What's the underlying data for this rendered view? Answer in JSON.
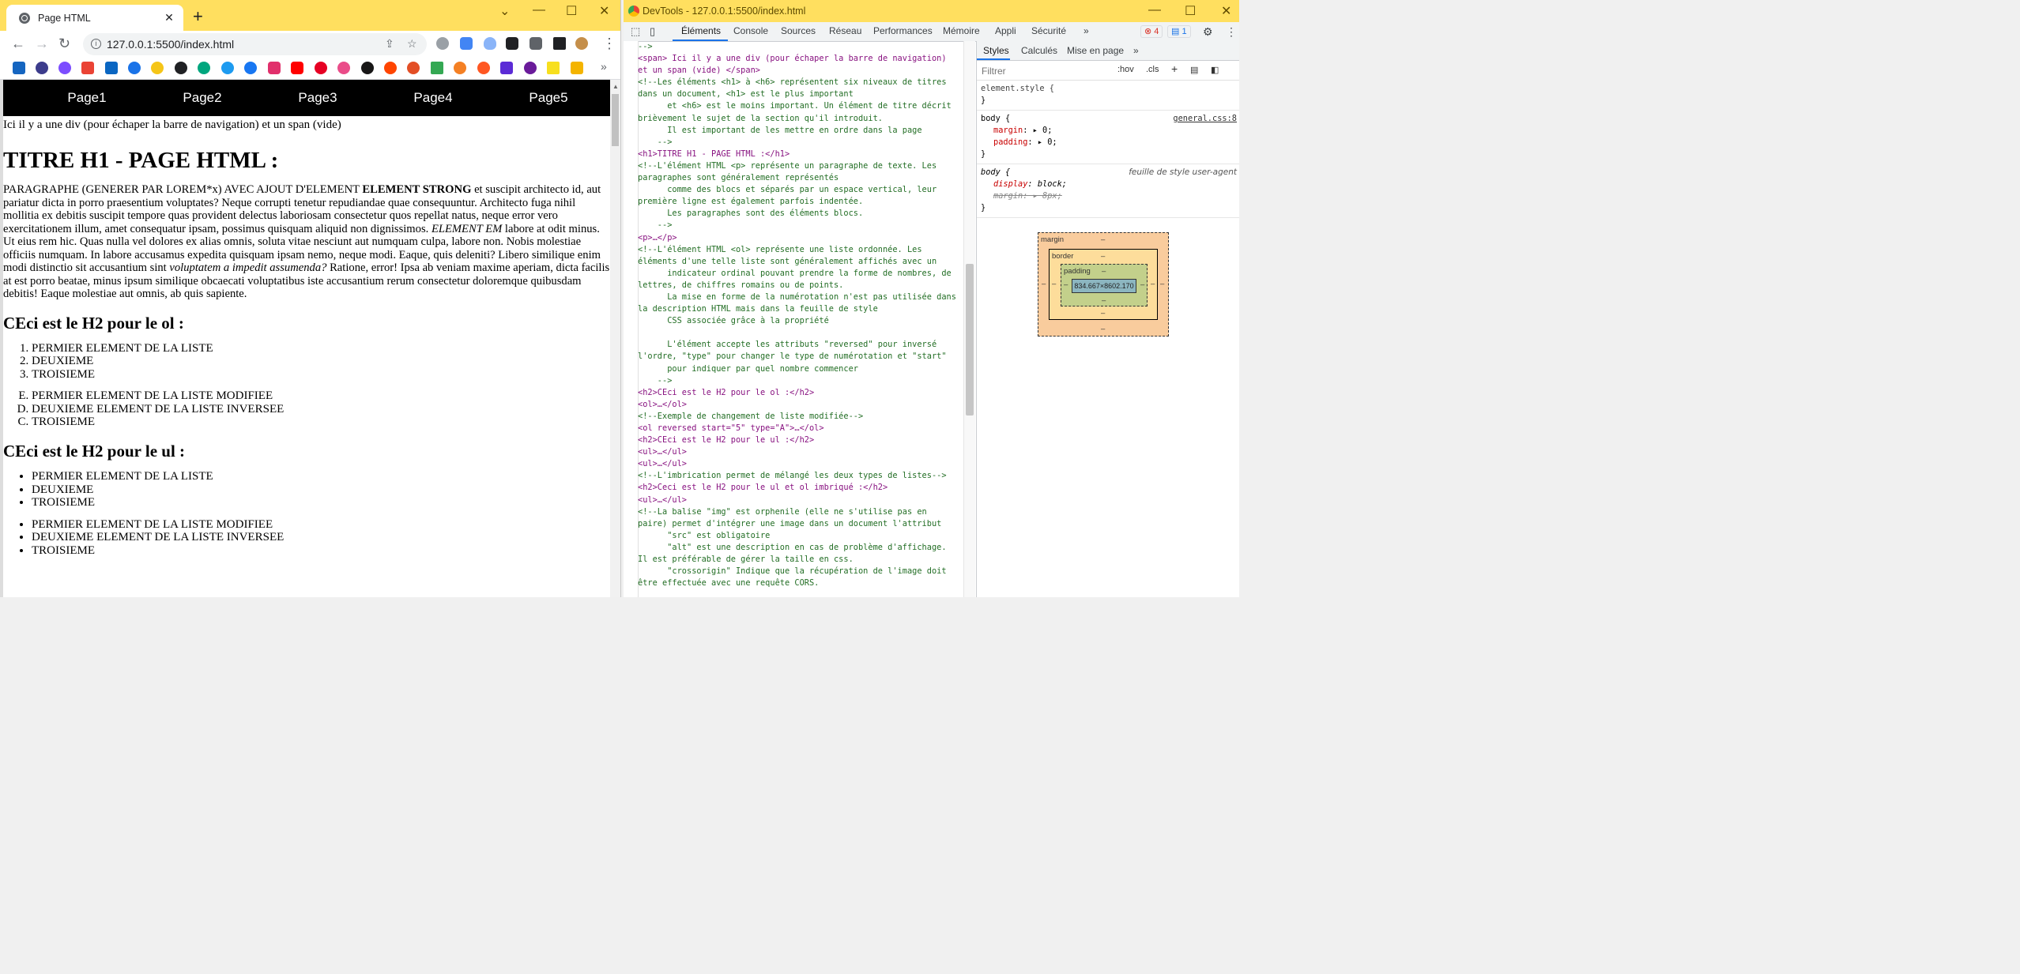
{
  "chrome": {
    "tab_title": "Page HTML",
    "tab_close": "✕",
    "new_tab": "+",
    "url": "127.0.0.1:5500/index.html",
    "window_controls": [
      "⌄",
      "—",
      "☐",
      "✕"
    ]
  },
  "page": {
    "nav": [
      "Page1",
      "Page2",
      "Page3",
      "Page4",
      "Page5"
    ],
    "intro": "Ici il y a une div (pour échaper la barre de navigation) et un span (vide)",
    "h1": "TITRE H1 - PAGE HTML :",
    "paragraph": {
      "part1": "PARAGRAPHE (GENERER PAR LOREM*x) AVEC AJOUT D'ELEMENT ",
      "strong": "ELEMENT STRONG",
      "part2": " et suscipit architecto id, aut pariatur dicta in porro praesentium voluptates? Neque corrupti tenetur repudiandae quae consequuntur. Architecto fuga nihil mollitia ex debitis suscipit tempore quas provident delectus laboriosam consectetur quos repellat natus, neque error vero exercitationem illum, amet consequatur ipsam, possimus quisquam aliquid non dignissimos. ",
      "em1": "ELEMENT EM",
      "part3": " labore at odit minus. Ut eius rem hic. Quas nulla vel dolores ex alias omnis, soluta vitae nesciunt aut numquam culpa, labore non. Nobis molestiae officiis numquam. In labore accusamus expedita quisquam ipsam nemo, neque modi. Eaque, quis deleniti? Libero similique enim modi distinctio sit accusantium sint ",
      "em2": "voluptatem a impedit assumenda?",
      "part4": " Ratione, error! Ipsa ab veniam maxime aperiam, dicta facilis at est porro beatae, minus ipsum similique obcaecati voluptatibus iste accusantium rerum consectetur doloremque quibusdam debitis! Eaque molestiae aut omnis, ab quis sapiente."
    },
    "h2_ol": "CEci est le H2 pour le ol :",
    "ol1": [
      "PERMIER ELEMENT DE LA LISTE",
      "DEUXIEME",
      "TROISIEME"
    ],
    "ol2": [
      "PERMIER ELEMENT DE LA LISTE MODIFIEE",
      "DEUXIEME ELEMENT DE LA LISTE INVERSEE",
      "TROISIEME"
    ],
    "h2_ul": "CEci est le H2 pour le ul :",
    "ul1": [
      "PERMIER ELEMENT DE LA LISTE",
      "DEUXIEME",
      "TROISIEME"
    ],
    "ul2": [
      "PERMIER ELEMENT DE LA LISTE MODIFIEE",
      "DEUXIEME ELEMENT DE LA LISTE INVERSEE",
      "TROISIEME"
    ]
  },
  "devtools": {
    "title": "DevTools - 127.0.0.1:5500/index.html",
    "tabs": [
      "Éléments",
      "Console",
      "Sources",
      "Réseau",
      "Performances",
      "Mémoire",
      "Appli",
      "Sécurité",
      "»"
    ],
    "errors": "4",
    "messages": "1",
    "elements_lines": [
      {
        "t": "cm",
        "s": "-->"
      },
      {
        "t": "tg",
        "s": "<span> Ici il y a une div (pour échaper la barre de navigation)"
      },
      {
        "t": "tg",
        "s": "et un span (vide) </span>"
      },
      {
        "t": "cm",
        "s": "<!--Les éléments <h1> à <h6> représentent six niveaux de titres"
      },
      {
        "t": "cm",
        "s": "dans un document, <h1> est le plus important"
      },
      {
        "t": "cm",
        "s": "      et <h6> est le moins important. Un élément de titre décrit"
      },
      {
        "t": "cm",
        "s": "brièvement le sujet de la section qu'il introduit."
      },
      {
        "t": "cm",
        "s": "      Il est important de les mettre en ordre dans la page"
      },
      {
        "t": "cm",
        "s": "    -->"
      },
      {
        "t": "tg",
        "s": "<h1>TITRE H1 - PAGE HTML :</h1>"
      },
      {
        "t": "cm",
        "s": "<!--L'élément HTML <p> représente un paragraphe de texte. Les"
      },
      {
        "t": "cm",
        "s": "paragraphes sont généralement représentés"
      },
      {
        "t": "cm",
        "s": "      comme des blocs et séparés par un espace vertical, leur"
      },
      {
        "t": "cm",
        "s": "première ligne est également parfois indentée."
      },
      {
        "t": "cm",
        "s": "      Les paragraphes sont des éléments blocs."
      },
      {
        "t": "cm",
        "s": "    -->"
      },
      {
        "t": "tgx",
        "s": "<p>…</p>"
      },
      {
        "t": "cm",
        "s": "<!--L'élément HTML <ol> représente une liste ordonnée. Les"
      },
      {
        "t": "cm",
        "s": "éléments d'une telle liste sont généralement affichés avec un"
      },
      {
        "t": "cm",
        "s": "      indicateur ordinal pouvant prendre la forme de nombres, de"
      },
      {
        "t": "cm",
        "s": "lettres, de chiffres romains ou de points."
      },
      {
        "t": "cm",
        "s": "      La mise en forme de la numérotation n'est pas utilisée dans"
      },
      {
        "t": "cm",
        "s": "la description HTML mais dans la feuille de style"
      },
      {
        "t": "cm",
        "s": "      CSS associée grâce à la propriété"
      },
      {
        "t": "cm",
        "s": " "
      },
      {
        "t": "cm",
        "s": "      L'élément accepte les attributs \"reversed\" pour inversé"
      },
      {
        "t": "cm",
        "s": "l'ordre, \"type\" pour changer le type de numérotation et \"start\""
      },
      {
        "t": "cm",
        "s": "      pour indiquer par quel nombre commencer"
      },
      {
        "t": "cm",
        "s": "    -->"
      },
      {
        "t": "tg",
        "s": "<h2>CEci est le H2 pour le ol :</h2>"
      },
      {
        "t": "tgx",
        "s": "<ol>…</ol>"
      },
      {
        "t": "cm",
        "s": "<!--Exemple de changement de liste modifiée-->"
      },
      {
        "t": "olx",
        "s": "<ol reversed start=\"5\" type=\"A\">…</ol>"
      },
      {
        "t": "tg",
        "s": "<h2>CEci est le H2 pour le ul :</h2>"
      },
      {
        "t": "tgx",
        "s": "<ul>…</ul>"
      },
      {
        "t": "tgx",
        "s": "<ul>…</ul>"
      },
      {
        "t": "cm",
        "s": "<!--L'imbrication permet de mélangé les deux types de listes-->"
      },
      {
        "t": "tg",
        "s": "<h2>Ceci est le H2 pour le ul et ol imbriqué :</h2>"
      },
      {
        "t": "tgx",
        "s": "<ul>…</ul>"
      },
      {
        "t": "cm",
        "s": "<!--La balise \"img\" est orphenile (elle ne s'utilise pas en"
      },
      {
        "t": "cm",
        "s": "paire) permet d'intégrer une image dans un document l'attribut"
      },
      {
        "t": "cm",
        "s": "      \"src\" est obligatoire"
      },
      {
        "t": "cm",
        "s": "      \"alt\" est une description en cas de problème d'affichage."
      },
      {
        "t": "cm",
        "s": "Il est préférable de gérer la taille en css."
      },
      {
        "t": "cm",
        "s": "      \"crossorigin\" Indique que la récupération de l'image doit"
      },
      {
        "t": "cm",
        "s": "être effectuée avec une requête CORS."
      }
    ],
    "styles_tabs": [
      "Styles",
      "Calculés",
      "Mise en page",
      "»"
    ],
    "filter_placeholder": "Filtrer",
    "filter_tools": [
      ":hov",
      ".cls",
      "+"
    ],
    "rules": {
      "element_style": "element.style {",
      "body1_selector": "body {",
      "body1_source": "general.css:8",
      "margin": "margin",
      "margin_val": "0;",
      "padding": "padding",
      "padding_val": "0;",
      "body2_selector": "body {",
      "body2_source": "feuille de style user-agent",
      "display": "display",
      "display_val": "block;",
      "ua_margin": "margin",
      "ua_margin_val": "8px;",
      "close": "}"
    },
    "boxmodel": {
      "margin_label": "margin",
      "border_label": "border",
      "padding_label": "padding",
      "content_size": "834.667×8602.170",
      "dash": "–"
    }
  }
}
